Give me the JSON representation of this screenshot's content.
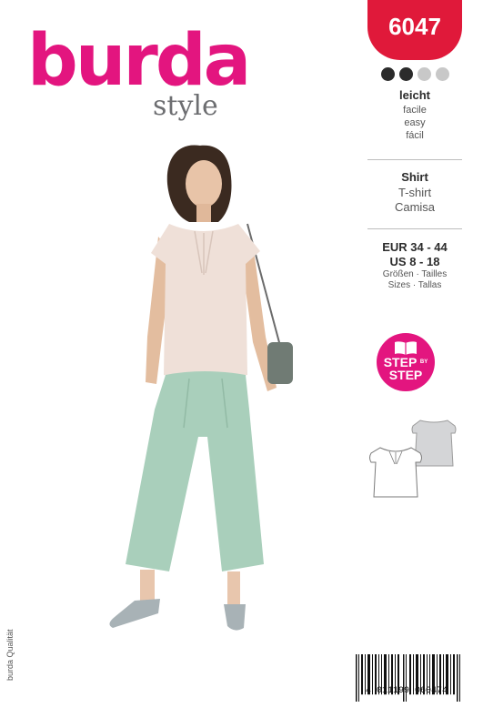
{
  "logo": {
    "brand": "burda",
    "sub": "style"
  },
  "pattern_number": "6047",
  "difficulty": {
    "dots": [
      "#2b2b2b",
      "#2b2b2b",
      "#c8c8c8",
      "#c8c8c8"
    ],
    "labels": [
      "leicht",
      "facile",
      "easy",
      "fácil"
    ]
  },
  "garment": {
    "labels": [
      "Shirt",
      "T-shirt",
      "Camisa"
    ]
  },
  "sizes": {
    "eur": "EUR 34 - 44",
    "us": "US 8 - 18",
    "label1": "Größen · Tailles",
    "label2": "Sizes · Tallas"
  },
  "step_badge": {
    "line1": "STEP",
    "by": "BY",
    "line2": "STEP"
  },
  "barcode": "4 011199 060474",
  "side_text": "burda Qualität",
  "colors": {
    "pink": "#e3157f",
    "red": "#e0193a",
    "grey": "#6d6e71"
  }
}
